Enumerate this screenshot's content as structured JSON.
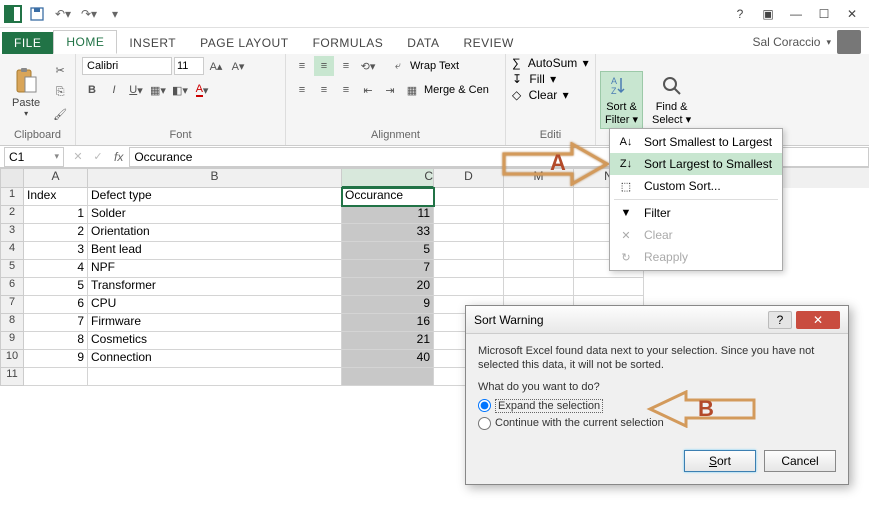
{
  "titlebar": {
    "help_title": "Microsoft Excel Help"
  },
  "tabs": {
    "file": "FILE",
    "home": "HOME",
    "insert": "INSERT",
    "page_layout": "PAGE LAYOUT",
    "formulas": "FORMULAS",
    "data": "DATA",
    "review": "REVIEW"
  },
  "user": {
    "name": "Sal Coraccio"
  },
  "ribbon": {
    "clipboard": {
      "paste": "Paste",
      "label": "Clipboard"
    },
    "font": {
      "name": "Calibri",
      "size": "11",
      "label": "Font"
    },
    "alignment": {
      "wrap": "Wrap Text",
      "merge": "Merge & Cen",
      "label": "Alignment"
    },
    "editing": {
      "autosum": "AutoSum",
      "fill": "Fill",
      "clear": "Clear",
      "sort_filter": "Sort & Filter",
      "find_select": "Find & Select",
      "label": "Editi"
    }
  },
  "dropdown": {
    "smallest": "Sort Smallest to Largest",
    "largest": "Sort Largest to Smallest",
    "custom": "Custom Sort...",
    "filter": "Filter",
    "clear": "Clear",
    "reapply": "Reapply"
  },
  "namebox": "C1",
  "formula": "Occurance",
  "columns": [
    "A",
    "B",
    "C",
    "D",
    "M",
    "N"
  ],
  "headers": {
    "a": "Index",
    "b": "Defect type",
    "c": "Occurance"
  },
  "rows": [
    {
      "idx": "1",
      "type": "Solder",
      "occ": "11"
    },
    {
      "idx": "2",
      "type": "Orientation",
      "occ": "33"
    },
    {
      "idx": "3",
      "type": "Bent lead",
      "occ": "5"
    },
    {
      "idx": "4",
      "type": "NPF",
      "occ": "7"
    },
    {
      "idx": "5",
      "type": "Transformer",
      "occ": "20"
    },
    {
      "idx": "6",
      "type": "CPU",
      "occ": "9"
    },
    {
      "idx": "7",
      "type": "Firmware",
      "occ": "16"
    },
    {
      "idx": "8",
      "type": "Cosmetics",
      "occ": "21"
    },
    {
      "idx": "9",
      "type": "Connection",
      "occ": "40"
    }
  ],
  "annotations": {
    "a": "A",
    "b": "B"
  },
  "dialog": {
    "title": "Sort Warning",
    "msg": "Microsoft Excel found data next to your selection.  Since you have not selected this data, it will not be sorted.",
    "prompt": "What do you want to do?",
    "opt_expand": "Expand the selection",
    "opt_continue": "Continue with the current selection",
    "sort": "Sort",
    "cancel": "Cancel"
  }
}
